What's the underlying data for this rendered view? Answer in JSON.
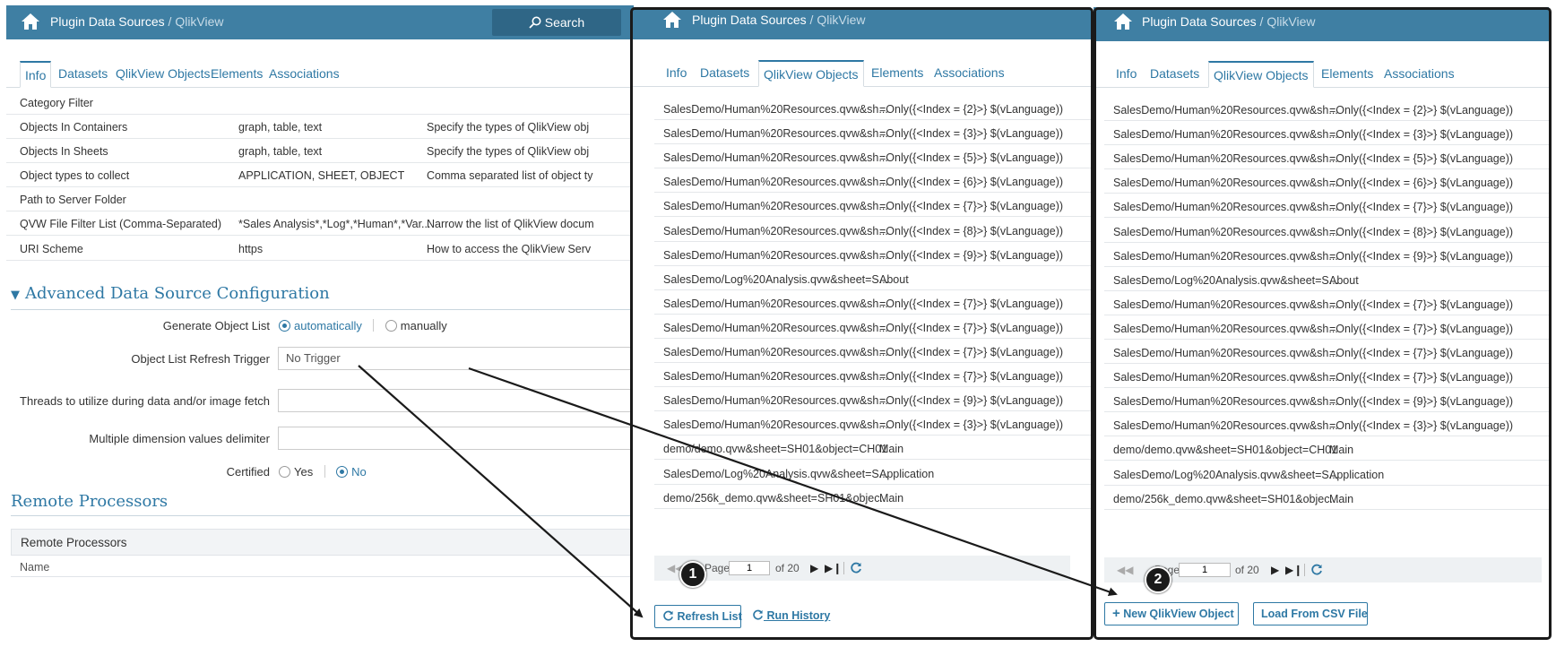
{
  "left": {
    "header": {
      "title": "Plugin Data Sources",
      "sep": " / ",
      "sub": "QlikView",
      "search_label": "Search"
    },
    "tabs": [
      "Info",
      "Datasets",
      "QlikView Objects",
      "Elements",
      "Associations"
    ],
    "rows": [
      {
        "name": "Category Filter",
        "value": "",
        "desc": ""
      },
      {
        "name": "Objects In Containers",
        "value": "graph, table, text",
        "desc": "Specify the types of QlikView obj"
      },
      {
        "name": "Objects In Sheets",
        "value": "graph, table, text",
        "desc": "Specify the types of QlikView obj"
      },
      {
        "name": "Object types to collect",
        "value": "APPLICATION, SHEET, OBJECT",
        "desc": "Comma separated list of object ty"
      },
      {
        "name": "Path to Server Folder",
        "value": "",
        "desc": ""
      },
      {
        "name": "QVW File Filter List (Comma-Separated)",
        "value": "*Sales Analysis*,*Log*,*Human*,*Var...",
        "desc": "Narrow the list of QlikView docum"
      },
      {
        "name": "URI Scheme",
        "value": "https",
        "desc": "How to access the QlikView Serv"
      }
    ],
    "advanced": {
      "title": "Advanced Data Source Configuration",
      "generate_label": "Generate Object List",
      "opt_auto": "automatically",
      "opt_manual": "manually",
      "refresh_label": "Object List Refresh Trigger",
      "refresh_value": "No Trigger",
      "threads_label": "Threads to utilize during data and/or image fetch",
      "delim_label": "Multiple dimension values delimiter",
      "certified_label": "Certified",
      "opt_yes": "Yes",
      "opt_no": "No"
    },
    "remote": {
      "title": "Remote Processors",
      "box_title": "Remote Processors",
      "col_name": "Name"
    }
  },
  "middle": {
    "header": {
      "title": "Plugin Data Sources",
      "sep": " / ",
      "sub": "QlikView"
    },
    "tabs": [
      "Info",
      "Datasets",
      "QlikView Objects",
      "Elements",
      "Associations"
    ],
    "rows": [
      {
        "a": "SalesDemo/Human%20Resources.qvw&sh...",
        "b": "=Only({<Index = {2}>} $(vLanguage))"
      },
      {
        "a": "SalesDemo/Human%20Resources.qvw&sh...",
        "b": "=Only({<Index = {3}>} $(vLanguage))"
      },
      {
        "a": "SalesDemo/Human%20Resources.qvw&sh...",
        "b": "=Only({<Index = {5}>} $(vLanguage))"
      },
      {
        "a": "SalesDemo/Human%20Resources.qvw&sh...",
        "b": "=Only({<Index = {6}>} $(vLanguage))"
      },
      {
        "a": "SalesDemo/Human%20Resources.qvw&sh...",
        "b": "=Only({<Index = {7}>} $(vLanguage))"
      },
      {
        "a": "SalesDemo/Human%20Resources.qvw&sh...",
        "b": "=Only({<Index = {8}>} $(vLanguage))"
      },
      {
        "a": "SalesDemo/Human%20Resources.qvw&sh...",
        "b": "=Only({<Index = {9}>} $(vLanguage))"
      },
      {
        "a": "SalesDemo/Log%20Analysis.qvw&sheet=S...",
        "b": "About"
      },
      {
        "a": "SalesDemo/Human%20Resources.qvw&sh...",
        "b": "=Only({<Index = {7}>} $(vLanguage))"
      },
      {
        "a": "SalesDemo/Human%20Resources.qvw&sh...",
        "b": "=Only({<Index = {7}>} $(vLanguage))"
      },
      {
        "a": "SalesDemo/Human%20Resources.qvw&sh...",
        "b": "=Only({<Index = {7}>} $(vLanguage))"
      },
      {
        "a": "SalesDemo/Human%20Resources.qvw&sh...",
        "b": "=Only({<Index = {7}>} $(vLanguage))"
      },
      {
        "a": "SalesDemo/Human%20Resources.qvw&sh...",
        "b": "=Only({<Index = {9}>} $(vLanguage))"
      },
      {
        "a": "SalesDemo/Human%20Resources.qvw&sh...",
        "b": "=Only({<Index = {3}>} $(vLanguage))"
      },
      {
        "a": "demo/demo.qvw&sheet=SH01&object=CH01",
        "b": "Main"
      },
      {
        "a": "SalesDemo/Log%20Analysis.qvw&sheet=S...",
        "b": "Application"
      },
      {
        "a": "demo/256k_demo.qvw&sheet=SH01&objec...",
        "b": "Main"
      }
    ],
    "pager": {
      "page_label": "Page",
      "page_value": "1",
      "of_label": "of 20"
    },
    "refresh_button": "Refresh List",
    "run_history": "Run History"
  },
  "right": {
    "header": {
      "title": "Plugin Data Sources",
      "sep": " / ",
      "sub": "QlikView"
    },
    "tabs": [
      "Info",
      "Datasets",
      "QlikView Objects",
      "Elements",
      "Associations"
    ],
    "pager": {
      "page_label": "Page",
      "page_value": "1",
      "of_label": "of 20"
    },
    "new_button": "New QlikView Object",
    "load_button": "Load From CSV File"
  },
  "callouts": [
    "1",
    "2"
  ],
  "colors": {
    "header": "#3f7fa3",
    "accent": "#2e78a4",
    "annotation": "#1a1a1a"
  }
}
